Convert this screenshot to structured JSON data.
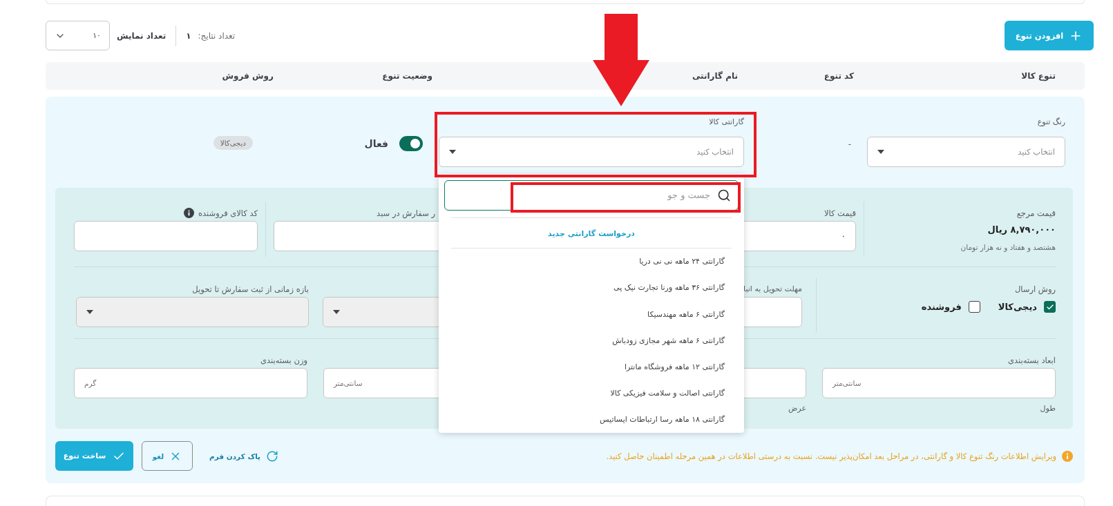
{
  "toolbar": {
    "add_button": "افزودن تنوع",
    "results_label": "تعداد نتایج:",
    "results_count": "۱",
    "page_size_label": "تعداد نمایش",
    "page_size": "۱۰"
  },
  "table": {
    "columns": [
      "تنوع کالا",
      "کد تنوع",
      "نام گارانتی",
      "وضعیت تنوع",
      "روش فروش"
    ]
  },
  "variant_row": {
    "color_field": {
      "label": "رنگ تنوع",
      "placeholder": "انتخاب کنید"
    },
    "variant_code": "-",
    "warranty_field": {
      "label": "گارانتی کالا",
      "placeholder": "انتخاب کنید"
    },
    "status": {
      "label": "فعال",
      "on": true
    },
    "sales_method": "دیجی‌کالا"
  },
  "warranty_dropdown": {
    "search_placeholder": "جست و جو",
    "request_link": "درخواست گارانتی جدید",
    "options": [
      {
        "label": "گارانتی ۲۴ ماهه نی نی دریا"
      },
      {
        "label": "گارانتی ۳۶ ماهه ورنا تجارت نیک پی"
      },
      {
        "label": "گارانتی ۶ ماهه مهندسیکا"
      },
      {
        "label": "گارانتی ۶ ماهه شهر مجازی زودباش"
      },
      {
        "label": "گارانتی ۱۲ ماهه فروشگاه مانترا"
      },
      {
        "label": "گارانتی اصالت و سلامت فیزیکی کالا"
      },
      {
        "label": "گارانتی ۱۸ ماهه رسا ارتباطات ایساتیس"
      }
    ]
  },
  "form": {
    "reference_price": {
      "label": "قیمت مرجع",
      "value": "۸,۷۹۰,۰۰۰ ریال",
      "in_words": "هشتصد و هفتاد و نه هزار تومان"
    },
    "price": {
      "label": "قیمت کالا",
      "value": "۰"
    },
    "max_cart": {
      "label": "ر سفارش در سبد"
    },
    "seller_code": {
      "label": "کد کالای فروشنده"
    },
    "shipping": {
      "label": "روش ارسال",
      "options": [
        {
          "label": "دیجی‌کالا",
          "checked": true
        },
        {
          "label": "فروشنده",
          "checked": false
        }
      ]
    },
    "lead_time": {
      "label": "مهلت تحویل به انبا"
    },
    "delivery_select": {
      "disabled": true
    },
    "delivery_window": {
      "label": "بازه زمانی از ثبت سفارش تا تحویل",
      "disabled": true
    },
    "dimensions": {
      "label": "ابعاد بسته‌بندی",
      "fields": [
        {
          "unit": "سانتی‌متر",
          "caption": "طول"
        },
        {
          "caption": "عرض"
        },
        {
          "unit": "سانتی‌متر"
        }
      ]
    },
    "weight": {
      "label": "وزن بسته‌بندی",
      "unit": "گرم"
    }
  },
  "notice": "ویرایش اطلاعات رنگ تنوع کالا و گارانتی، در مراحل بعد امکان‌پذیر نیست. نسبت به درستی اطلاعات در همین مرحله اطمینان حاصل کنید.",
  "actions": {
    "reset": "پاک کردن فرم",
    "cancel": "لغو",
    "submit": "ساخت تنوع"
  }
}
